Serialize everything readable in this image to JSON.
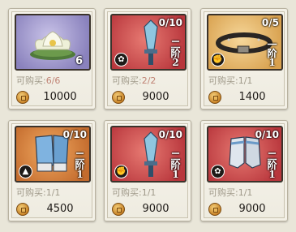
{
  "limit_label": "可购买:",
  "items": [
    {
      "name": "lotus",
      "badge": "",
      "count": "6",
      "rank": "",
      "limit": "6/6",
      "price": "10000",
      "bg": "purple",
      "side_icon": ""
    },
    {
      "name": "red-blade",
      "badge": "0/10",
      "count": "2",
      "rank": "二阶",
      "limit": "2/2",
      "price": "9000",
      "bg": "red",
      "side_icon": "flower-icon"
    },
    {
      "name": "belt",
      "badge": "0/5",
      "count": "1",
      "rank": "一阶",
      "limit": "1/1",
      "price": "1400",
      "bg": "gold",
      "side_icon": "fist-icon"
    },
    {
      "name": "boots",
      "badge": "0/10",
      "count": "1",
      "rank": "二阶",
      "limit": "1/1",
      "price": "4500",
      "bg": "orange",
      "side_icon": "flame-icon"
    },
    {
      "name": "red-blade-2",
      "badge": "0/10",
      "count": "1",
      "rank": "二阶",
      "limit": "1/1",
      "price": "9000",
      "bg": "red",
      "side_icon": "fist-icon"
    },
    {
      "name": "shin-guards",
      "badge": "0/10",
      "count": "1",
      "rank": "二阶",
      "limit": "1/1",
      "price": "9000",
      "bg": "red",
      "side_icon": "flower-icon"
    }
  ]
}
